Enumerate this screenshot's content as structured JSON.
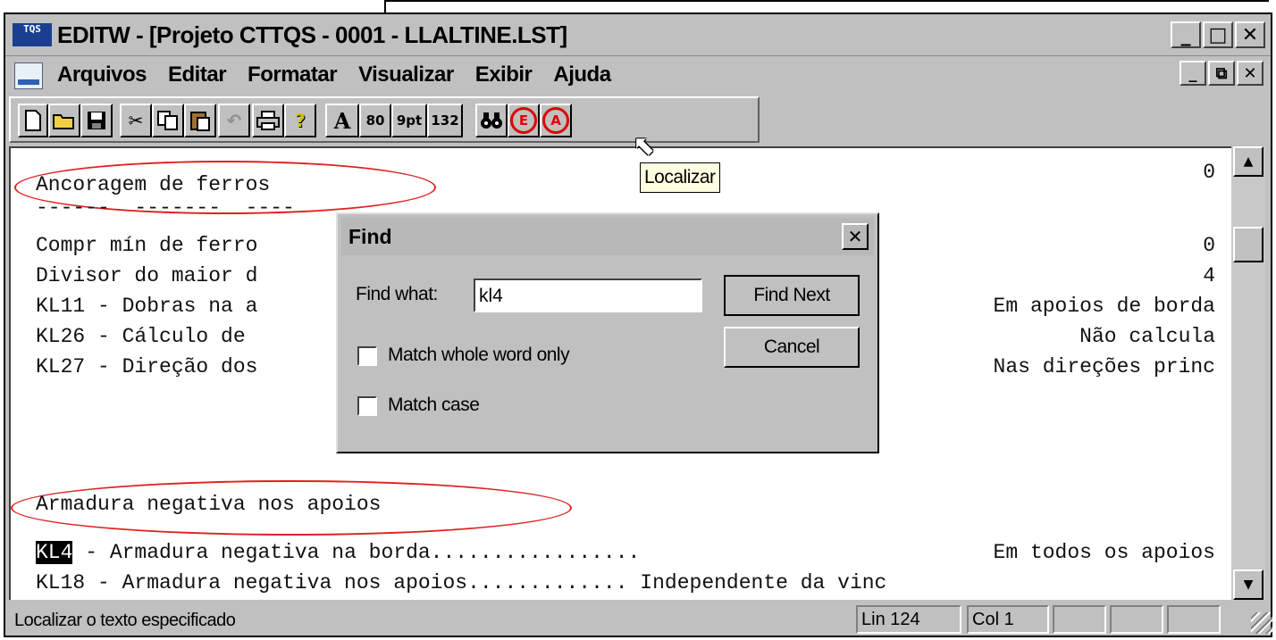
{
  "window": {
    "app_icon": "TQS",
    "title": "EDITW - [Projeto CTTQS - 0001 - LLALTINE.LST]",
    "controls": [
      "_",
      "□",
      "✕"
    ]
  },
  "menu": {
    "items": [
      "Arquivos",
      "Editar",
      "Formatar",
      "Visualizar",
      "Exibir",
      "Ajuda"
    ],
    "mdi_controls": [
      "_",
      "⧉",
      "✕"
    ]
  },
  "toolbar": {
    "icons": [
      "new-icon",
      "open-icon",
      "save-icon",
      "cut-icon",
      "copy-icon",
      "paste-icon",
      "undo-icon",
      "print-icon",
      "help-icon"
    ],
    "font_button": "A",
    "col80": "80",
    "pt9": "9pt",
    "col132": "132",
    "find_icon": "binoculars-icon",
    "e_button": "E",
    "a_button": "A"
  },
  "tooltip": "Localizar",
  "editor": {
    "heading1": "Ancoragem de ferros",
    "underline1": "------  -------  ----",
    "lines_left": [
      "Compr mín de ferro",
      "Divisor do maior d",
      "KL11 - Dobras na a",
      "KL26 - Cálculo de",
      "KL27 - Direção dos"
    ],
    "right_values": [
      "0",
      "0",
      "4",
      "Em apoios de borda",
      "Não calcula",
      "Nas direções princ"
    ],
    "heading2": "Armadura negativa nos apoios",
    "kl4_code": "KL4",
    "kl4_rest": " - Armadura negativa na borda.................",
    "kl4_value": "Em todos os apoios",
    "kl18_line": "KL18 - Armadura negativa nos apoios............. Independente da vinc"
  },
  "find_dialog": {
    "title": "Find",
    "find_what_label": "Find what:",
    "find_what_value": "kl4",
    "find_next": "Find Next",
    "cancel": "Cancel",
    "match_whole_word": "Match whole word only",
    "match_case": "Match case"
  },
  "status": {
    "message": "Localizar o texto especificado",
    "line": "Lin 124",
    "col": "Col 1"
  }
}
